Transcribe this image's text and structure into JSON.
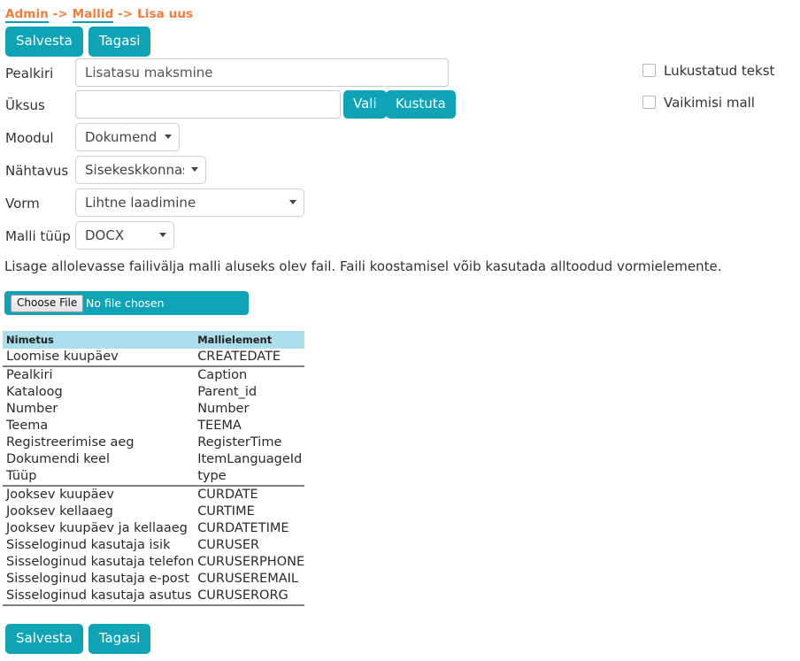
{
  "breadcrumb": {
    "item1": "Admin",
    "sep1": " -> ",
    "item2": "Mallid",
    "sep2": " -> ",
    "item3": "Lisa uus"
  },
  "toolbar": {
    "save_label": "Salvesta",
    "back_label": "Tagasi"
  },
  "form": {
    "title": {
      "label": "Pealkiri",
      "value": "Lisatasu maksmine"
    },
    "unit": {
      "label": "Üksus",
      "value": "",
      "select_button": "Vali",
      "delete_button": "Kustuta"
    },
    "module": {
      "label": "Moodul",
      "value": "Dokumendid"
    },
    "visibility": {
      "label": "Nähtavus",
      "value": "Sisekeskkonnas"
    },
    "form_type": {
      "label": "Vorm",
      "value": "Lihtne laadimine"
    },
    "template_type": {
      "label": "Malli tüüp",
      "value": "DOCX"
    }
  },
  "options": {
    "locked_text": "Lukustatud tekst",
    "default_template": "Vaikimisi mall"
  },
  "instruction": "Lisage allolevasse failivälja malli aluseks olev fail. Faili koostamisel võib kasutada alltoodud vormielemente.",
  "file_upload": {
    "choose_label": "Choose File",
    "status": "No file chosen"
  },
  "table": {
    "headers": [
      "Nimetus",
      "Mallielement"
    ],
    "groups": [
      {
        "rows": [
          [
            "Loomise kuupäev",
            "CREATEDATE"
          ]
        ]
      },
      {
        "rows": [
          [
            "Pealkiri",
            "Caption"
          ],
          [
            "Kataloog",
            "Parent_id"
          ],
          [
            "Number",
            "Number"
          ],
          [
            "Teema",
            "TEEMA"
          ],
          [
            "Registreerimise aeg",
            "RegisterTime"
          ],
          [
            "Dokumendi keel",
            "ItemLanguageId"
          ],
          [
            "Tüüp",
            "type"
          ]
        ]
      },
      {
        "rows": [
          [
            "Jooksev kuupäev",
            "CURDATE"
          ],
          [
            "Jooksev kellaaeg",
            "CURTIME"
          ],
          [
            "Jooksev kuupäev ja kellaaeg",
            "CURDATETIME"
          ],
          [
            "Sisseloginud kasutaja isik",
            "CURUSER"
          ],
          [
            "Sisseloginud kasutaja telefon",
            "CURUSERPHONE"
          ],
          [
            "Sisseloginud kasutaja e-post",
            "CURUSEREMAIL"
          ],
          [
            "Sisseloginud kasutaja asutus",
            "CURUSERORG"
          ]
        ]
      }
    ]
  },
  "colors": {
    "accent": "#0ea3b5",
    "breadcrumb": "#f57c3a",
    "table_header": "#addeec"
  }
}
